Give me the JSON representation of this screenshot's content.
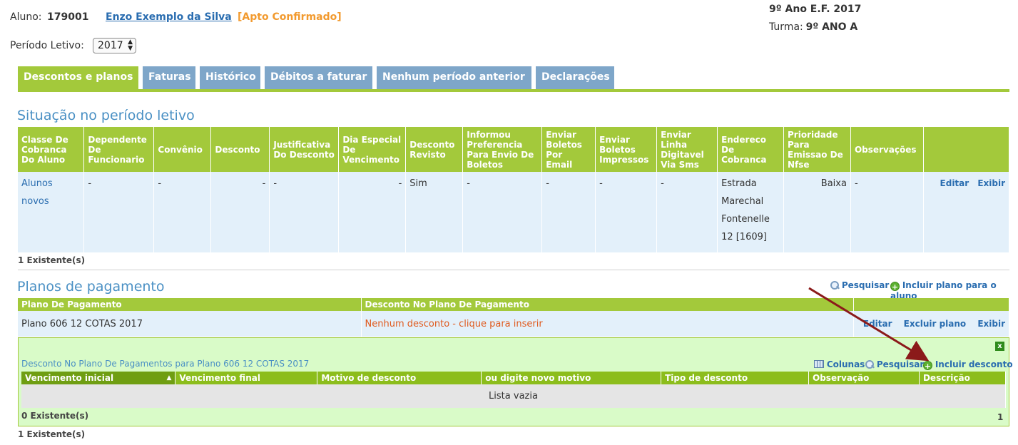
{
  "header": {
    "aluno_label": "Aluno:",
    "aluno_id": "179001",
    "student_name": "Enzo Exemplo da Silva",
    "status": "[Apto Confirmado]",
    "grade": "9º Ano E.F. 2017",
    "turma_label": "Turma:",
    "turma_value": "9º ANO A",
    "periodo_label": "Período Letivo:",
    "periodo_value": "2017"
  },
  "tabs": [
    {
      "label": "Descontos e planos",
      "active": true
    },
    {
      "label": "Faturas"
    },
    {
      "label": "Histórico"
    },
    {
      "label": "Débitos a faturar"
    },
    {
      "label": "Nenhum período anterior"
    },
    {
      "label": "Declarações"
    }
  ],
  "situacao": {
    "title": "Situação no período letivo",
    "columns": [
      "Classe De Cobranca Do Aluno",
      "Dependente De Funcionario",
      "Convênio",
      "Desconto",
      "Justificativa Do Desconto",
      "Dia Especial De Vencimento",
      "Desconto Revisto",
      "Informou Preferencia Para Envio De Boletos",
      "Enviar Boletos Por Email",
      "Enviar Boletos Impressos",
      "Enviar Linha Digitavel Via Sms",
      "Endereco De Cobranca",
      "Prioridade Para Emissao De Nfse",
      "Observações",
      ""
    ],
    "row": {
      "classe": "Alunos novos",
      "dependente": "-",
      "convenio": "-",
      "desconto": "-",
      "justificativa": "-",
      "dia_especial": "-",
      "desconto_revisto": "Sim",
      "informou_preferencia": "-",
      "boletos_email": "-",
      "boletos_impressos": "-",
      "linha_sms": "-",
      "endereco": "Estrada Marechal Fontenelle 12 [1609]",
      "prioridade": "Baixa",
      "observacoes": "-",
      "editar": "Editar",
      "exibir": "Exibir"
    },
    "count": "1 Existente(s)"
  },
  "planos": {
    "title": "Planos de pagamento",
    "pesquisar": "Pesquisar",
    "incluir_plano": "Incluir plano para o aluno",
    "columns": [
      "Plano De Pagamento",
      "Desconto No Plano De Pagamento",
      ""
    ],
    "row": {
      "plano": "Plano 606 12 COTAS 2017",
      "desconto": "Nenhum desconto - clique para inserir",
      "editar": "Editar",
      "excluir": "Excluir plano",
      "exibir": "Exibir"
    },
    "count": "1 Existente(s)"
  },
  "desconto_plano": {
    "title": "Desconto No Plano De Pagamentos para Plano 606 12 COTAS 2017",
    "close_label": "x",
    "colunas": "Colunas",
    "pesquisar": "Pesquisar",
    "incluir": "Incluir desconto",
    "columns": [
      "Vencimento inicial",
      "Vencimento final",
      "Motivo de desconto",
      "ou digite novo motivo",
      "Tipo de desconto",
      "Observação",
      "Descrição"
    ],
    "sort_indicator": "▲",
    "empty": "Lista vazia",
    "count": "0 Existente(s)",
    "page": "1"
  },
  "colors": {
    "green": "#a3c93b",
    "tab_blue": "#7ea6c9",
    "link_blue": "#2a6db0",
    "orange": "#f29a2e",
    "arrow": "#8b1a1a"
  }
}
